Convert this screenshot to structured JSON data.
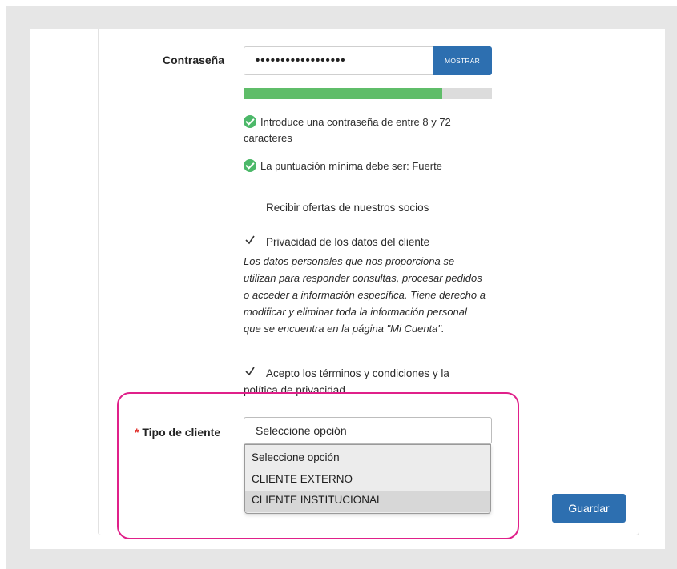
{
  "form": {
    "password_label": "Contraseña",
    "password_value": "••••••••••••••••••",
    "show_button": "MOSTRAR",
    "strength_fraction": 0.8,
    "hint_length_line1": "Introduce una contraseña de entre 8 y 72",
    "hint_length_line2": "caracteres",
    "hint_score": "La puntuación mínima debe ser: Fuerte",
    "offers_label": "Recibir ofertas de nuestros socios",
    "offers_checked": false,
    "privacy_label": "Privacidad de los datos del cliente",
    "privacy_checked": true,
    "privacy_text": [
      "Los datos personales que nos proporciona se",
      "utilizan para responder consultas, procesar pedidos",
      "o acceder a información específica. Tiene derecho a",
      "modificar y eliminar toda la información personal",
      "que se encuentra en la página \"Mi Cuenta\"."
    ],
    "terms_line1": "Acepto los términos y condiciones y la",
    "terms_line2": "política de privacidad.",
    "terms_checked": true,
    "required_mark": "*",
    "client_type_label": "Tipo de cliente",
    "client_type_selected": "Seleccione opción",
    "client_type_options": [
      "Seleccione opción",
      "CLIENTE EXTERNO",
      "CLIENTE INSTITUCIONAL"
    ],
    "client_type_hovered": 2,
    "save_button": "Guardar"
  },
  "colors": {
    "primary": "#2d6fb0",
    "success": "#4cb869",
    "required": "#e02b27",
    "highlight": "#e0208a"
  }
}
